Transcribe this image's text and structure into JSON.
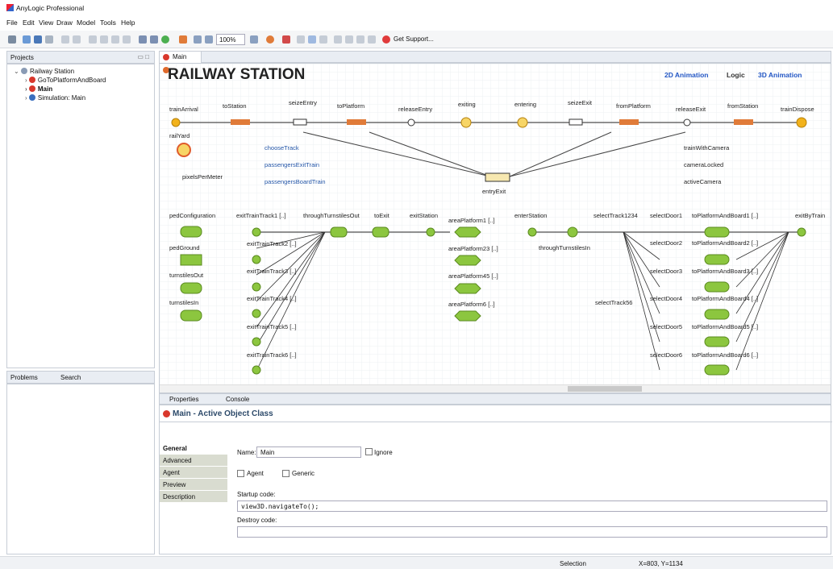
{
  "app": {
    "title": "AnyLogic Professional"
  },
  "menus": [
    "File",
    "Edit",
    "View",
    "Draw",
    "Model",
    "Tools",
    "Help"
  ],
  "toolbar": {
    "zoom": "100%",
    "support": "Get Support..."
  },
  "projects": {
    "tab": "Projects",
    "items": [
      "Railway Station",
      "GoToPlatformAndBoard",
      "Main",
      "Simulation: Main"
    ]
  },
  "problems": {
    "tab1": "Problems",
    "tab2": "Search"
  },
  "editor": {
    "tab": "Main",
    "title": "RAILWAY STATION",
    "links": [
      "2D Animation",
      "Logic",
      "3D Animation"
    ],
    "row1": [
      "trainArrival",
      "toStation",
      "seizeEntry",
      "toPlatform",
      "releaseEntry",
      "exiting",
      "entering",
      "seizeExit",
      "fromPlatform",
      "releaseExit",
      "fromStation",
      "trainDispose"
    ],
    "railYard": "railYard",
    "pixels": "pixelsPerMeter",
    "functions": [
      "chooseTrack",
      "passengersExitTrain",
      "passengersBoardTrain"
    ],
    "vars": [
      "trainWithCamera",
      "cameraLocked",
      "activeCamera"
    ],
    "entryExit": "entryExit",
    "ped": [
      "pedConfiguration",
      "pedGround",
      "turnstilesOut",
      "turnstilesIn"
    ],
    "exitTracks": [
      "exitTrainTrack1 [..]",
      "exitTrainTrack2 [..]",
      "exitTrainTrack3 [..]",
      "exitTrainTrack4 [..]",
      "exitTrainTrack5 [..]",
      "exitTrainTrack6 [..]"
    ],
    "flow2": [
      "throughTurnstilesOut",
      "toExit",
      "exitStation"
    ],
    "areas": [
      "areaPlatform1 [..]",
      "areaPlatform23 [..]",
      "areaPlatform45 [..]",
      "areaPlatform6 [..]"
    ],
    "flow3": [
      "enterStation",
      "throughTurnstilesIn",
      "selectTrack1234",
      "selectTrack56",
      "exitByTrain"
    ],
    "doors": [
      "selectDoor1",
      "selectDoor2",
      "selectDoor3",
      "selectDoor4",
      "selectDoor5",
      "selectDoor6"
    ],
    "boards": [
      "toPlatformAndBoard1 [..]",
      "toPlatformAndBoard2 [..]",
      "toPlatformAndBoard3 [..]",
      "toPlatformAndBoard4 [..]",
      "toPlatformAndBoard5 [..]",
      "toPlatformAndBoard6 [..]"
    ]
  },
  "properties": {
    "tab1": "Properties",
    "tab2": "Console",
    "header": "Main - Active Object Class",
    "side": [
      "General",
      "Advanced",
      "Agent",
      "Preview",
      "Description"
    ],
    "name_label": "Name:",
    "name_value": "Main",
    "ignore": "Ignore",
    "agent": "Agent",
    "generic": "Generic",
    "startup_label": "Startup code:",
    "startup_value": "view3D.navigateTo();",
    "destroy_label": "Destroy code:"
  },
  "status": {
    "mode": "Selection",
    "coords": "X=803, Y=1134"
  }
}
